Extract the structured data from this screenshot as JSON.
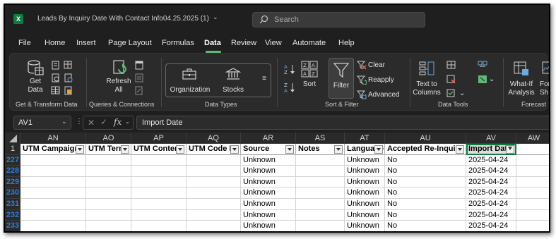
{
  "titlebar": {
    "app_icon": "X",
    "doc_title": "Leads By Inquiry Date With Contact Info04.25.2025 (1)",
    "title_chevron": "⌄",
    "search_placeholder": "Search"
  },
  "menu": {
    "tabs": [
      "File",
      "Home",
      "Insert",
      "Page Layout",
      "Formulas",
      "Data",
      "Review",
      "View",
      "Automate",
      "Help"
    ],
    "active": "Data"
  },
  "ribbon": {
    "get_data": "Get\nData",
    "refresh_all": "Refresh\nAll",
    "organization": "Organization",
    "stocks": "Stocks",
    "sort": "Sort",
    "filter": "Filter",
    "clear": "Clear",
    "reapply": "Reapply",
    "advanced": "Advanced",
    "text_to_columns": "Text to\nColumns",
    "what_if": "What-If\nAnalysis",
    "forecast_sheet": "For\nSh",
    "groups": {
      "get_transform": "Get & Transform Data",
      "queries": "Queries & Connections",
      "data_types": "Data Types",
      "sort_filter": "Sort & Filter",
      "data_tools": "Data Tools",
      "forecast": "Forecast"
    },
    "icons": {
      "get_data": "database-icon",
      "refresh": "refresh-icon",
      "organization": "briefcase-icon",
      "stocks": "bank-icon",
      "filter": "funnel-icon",
      "text_to_columns": "split-columns-icon",
      "what_if": "what-if-icon"
    }
  },
  "formula_bar": {
    "name_box": "AV1",
    "cancel": "✕",
    "enter": "✓",
    "fx": "fx",
    "formula": "Import Date"
  },
  "sheet": {
    "columns": [
      "AN",
      "AO",
      "AP",
      "AQ",
      "AR",
      "AS",
      "AT",
      "AU",
      "AV",
      "AW"
    ],
    "header_row_number": "1",
    "headers": [
      "UTM Campaign",
      "UTM Term",
      "UTM Content",
      "UTM Code Id",
      "Source",
      "Notes",
      "Language",
      "Accepted Re-Inquiry",
      "Import Date",
      ""
    ],
    "rows": [
      {
        "num": "227",
        "cells": [
          "",
          "",
          "",
          "",
          "Unknown",
          "",
          "Unknown",
          "No",
          "2025-04-24",
          ""
        ]
      },
      {
        "num": "228",
        "cells": [
          "",
          "",
          "",
          "",
          "Unknown",
          "",
          "Unknown",
          "No",
          "2025-04-24",
          ""
        ]
      },
      {
        "num": "229",
        "cells": [
          "",
          "",
          "",
          "",
          "Unknown",
          "",
          "Unknown",
          "No",
          "2025-04-24",
          ""
        ]
      },
      {
        "num": "230",
        "cells": [
          "",
          "",
          "",
          "",
          "Unknown",
          "",
          "Unknown",
          "No",
          "2025-04-24",
          ""
        ]
      },
      {
        "num": "231",
        "cells": [
          "",
          "",
          "",
          "",
          "Unknown",
          "",
          "Unknown",
          "No",
          "2025-04-24",
          ""
        ]
      },
      {
        "num": "232",
        "cells": [
          "",
          "",
          "",
          "",
          "Unknown",
          "",
          "Unknown",
          "No",
          "2025-04-24",
          ""
        ]
      },
      {
        "num": "233",
        "cells": [
          "",
          "",
          "",
          "",
          "Unknown",
          "",
          "Unknown",
          "No",
          "2025-04-24",
          ""
        ]
      }
    ],
    "accent_color": "#107c41",
    "filtered_row_color": "#2f7cd6"
  }
}
